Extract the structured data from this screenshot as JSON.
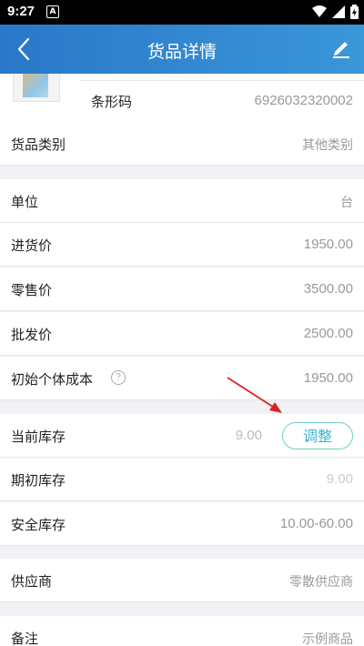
{
  "statusbar": {
    "time": "9:27",
    "notif_label": "A"
  },
  "header": {
    "title": "货品详情"
  },
  "barcode": {
    "label": "条形码",
    "value": "6926032320002"
  },
  "fields": {
    "category": {
      "label": "货品类别",
      "value": "其他类别"
    },
    "unit": {
      "label": "单位",
      "value": "台"
    },
    "purchase_price": {
      "label": "进货价",
      "value": "1950.00"
    },
    "retail_price": {
      "label": "零售价",
      "value": "3500.00"
    },
    "wholesale_price": {
      "label": "批发价",
      "value": "2500.00"
    },
    "initial_cost": {
      "label": "初始个体成本",
      "help": "?",
      "value": "1950.00"
    },
    "current_stock": {
      "label": "当前库存",
      "value": "9.00",
      "button": "调整"
    },
    "initial_stock": {
      "label": "期初库存",
      "value": "9.00"
    },
    "safety_stock": {
      "label": "安全库存",
      "value": "10.00-60.00"
    },
    "supplier": {
      "label": "供应商",
      "value": "零散供应商"
    },
    "remark": {
      "label": "备注",
      "value": "示例商品"
    }
  },
  "colors": {
    "header_start": "#2a78c9",
    "header_end": "#3a97d8",
    "accent": "#3bb2cc",
    "annotation_arrow": "#e02020"
  }
}
